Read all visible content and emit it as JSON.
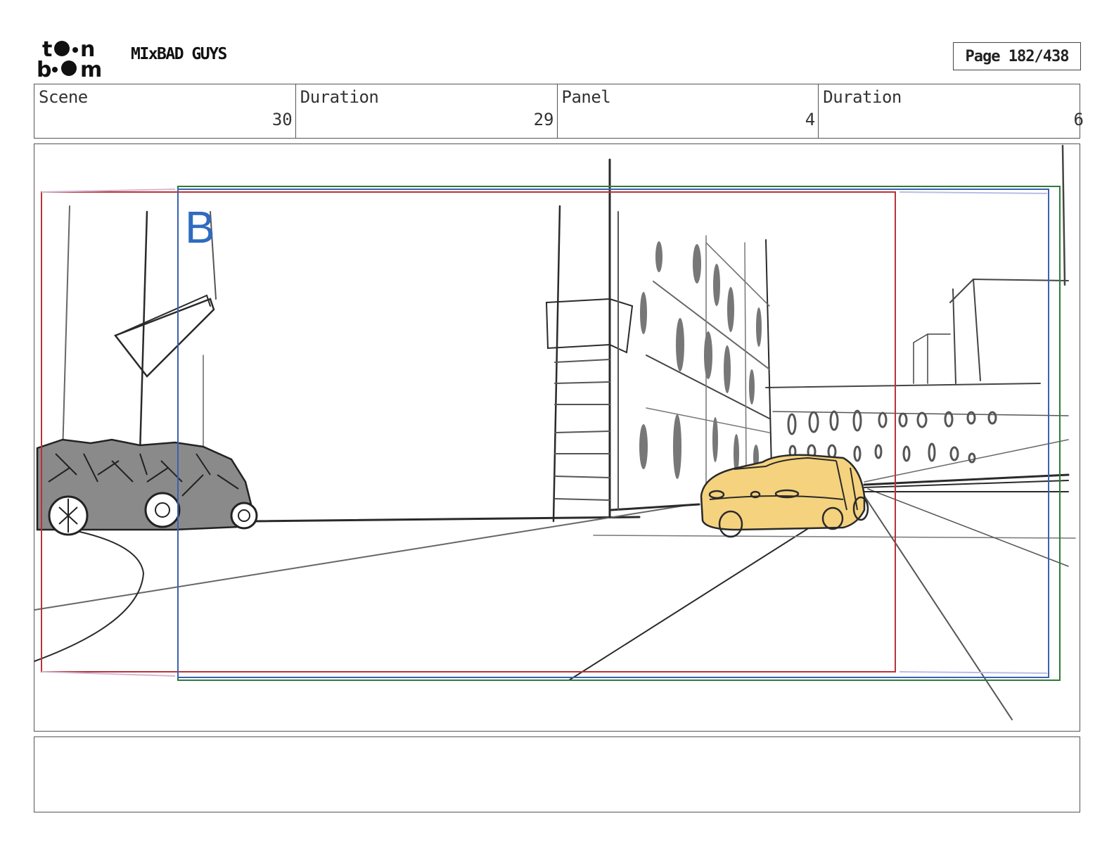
{
  "header": {
    "logo_alt": "toon boom",
    "project_title": "MIxBAD GUYS",
    "page_label": "Page 182/438"
  },
  "info": {
    "scene_label": "Scene",
    "scene_value": "30",
    "scene_duration_label": "Duration",
    "scene_duration_value": "29",
    "panel_label": "Panel",
    "panel_value": "4",
    "panel_duration_label": "Duration",
    "panel_duration_value": "6"
  },
  "panel": {
    "layer_letter": "B",
    "colors": {
      "frame_red": "#b8333a",
      "frame_green": "#2f7a3a",
      "frame_blue": "#3a62b0",
      "letter_blue": "#2f6bbf",
      "car_yellow": "#f5d27e",
      "sketch": "#2a2a2a"
    }
  },
  "notes": {
    "text": ""
  }
}
